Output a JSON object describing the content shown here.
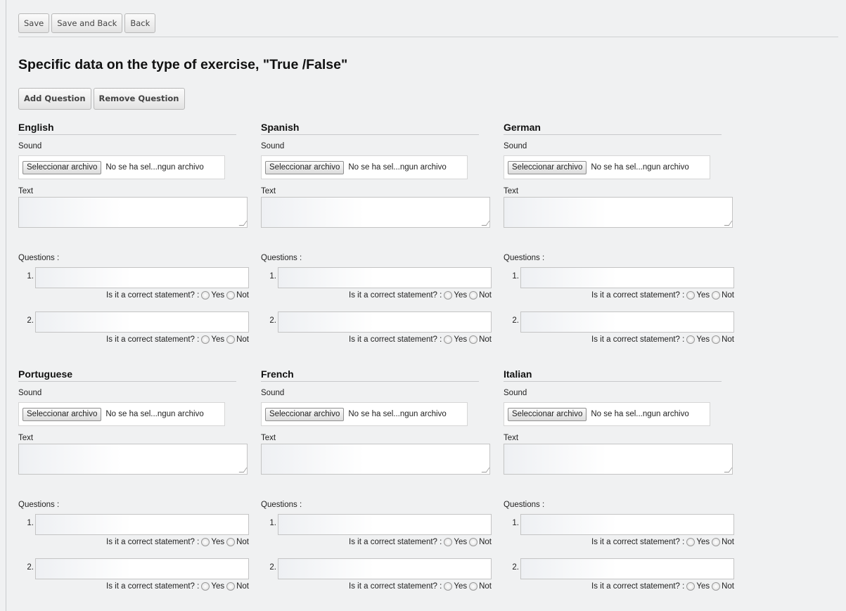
{
  "toolbar": {
    "save": "Save",
    "save_back": "Save and Back",
    "back": "Back"
  },
  "title": "Specific data on the type of exercise, \"True /False\"",
  "question_buttons": {
    "add": "Add Question",
    "remove": "Remove Question"
  },
  "labels": {
    "sound": "Sound",
    "text": "Text",
    "questions": "Questions :",
    "statement": "Is it a correct statement? :",
    "yes": "Yes",
    "not": "Not",
    "file_button": "Seleccionar archivo",
    "file_status": "No se ha sel...ngun archivo"
  },
  "languages": [
    {
      "name": "English",
      "questions": [
        {
          "number": "1.",
          "text": "",
          "answer": null
        },
        {
          "number": "2.",
          "text": "",
          "answer": null
        }
      ]
    },
    {
      "name": "Spanish",
      "questions": [
        {
          "number": "1.",
          "text": "",
          "answer": null
        },
        {
          "number": "2.",
          "text": "",
          "answer": null
        }
      ]
    },
    {
      "name": "German",
      "questions": [
        {
          "number": "1.",
          "text": "",
          "answer": null
        },
        {
          "number": "2.",
          "text": "",
          "answer": null
        }
      ]
    },
    {
      "name": "Portuguese",
      "questions": [
        {
          "number": "1.",
          "text": "",
          "answer": null
        },
        {
          "number": "2.",
          "text": "",
          "answer": null
        }
      ]
    },
    {
      "name": "French",
      "questions": [
        {
          "number": "1.",
          "text": "",
          "answer": null
        },
        {
          "number": "2.",
          "text": "",
          "answer": null
        }
      ]
    },
    {
      "name": "Italian",
      "questions": [
        {
          "number": "1.",
          "text": "",
          "answer": null
        },
        {
          "number": "2.",
          "text": "",
          "answer": null
        }
      ]
    }
  ]
}
